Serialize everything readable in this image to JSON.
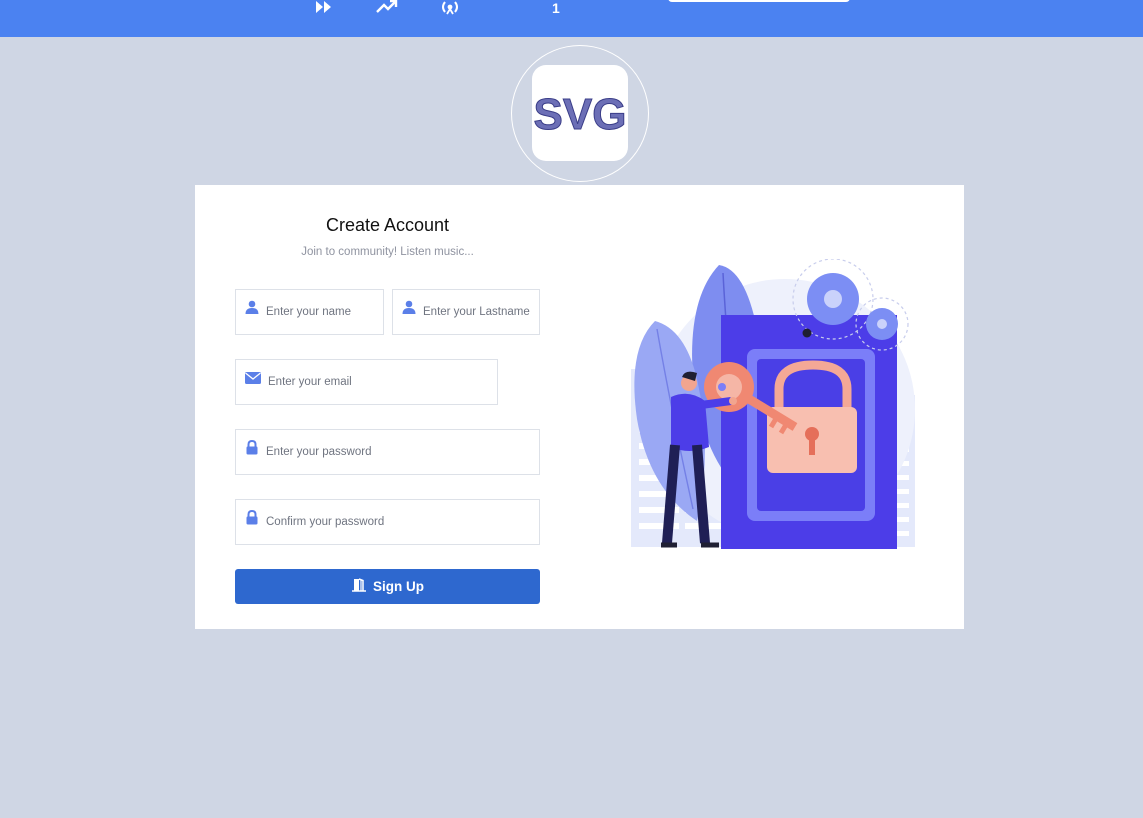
{
  "nav": {
    "icons": [
      "fast-forward-icon",
      "trending-up-icon",
      "broadcast-icon"
    ],
    "badge": "1"
  },
  "logo": {
    "text": "SVG"
  },
  "form": {
    "title": "Create Account",
    "subtitle": "Join to community! Listen music...",
    "first_name": {
      "placeholder": "Enter your name",
      "icon": "user-icon"
    },
    "last_name": {
      "placeholder": "Enter your Lastname",
      "icon": "user-icon"
    },
    "email": {
      "placeholder": "Enter your email",
      "icon": "envelope-icon"
    },
    "password": {
      "placeholder": "Enter your password",
      "icon": "lock-icon"
    },
    "confirm_password": {
      "placeholder": "Confirm your password",
      "icon": "lock-icon"
    },
    "submit_label": "Sign Up"
  },
  "colors": {
    "topbar": "#4b82f1",
    "background": "#cfd6e4",
    "button": "#2e68cf",
    "icon": "#5b7fe8"
  }
}
